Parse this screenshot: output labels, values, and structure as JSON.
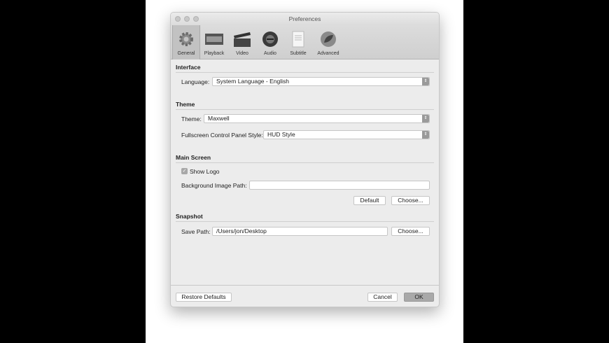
{
  "window": {
    "title": "Preferences"
  },
  "toolbar": [
    {
      "label": "General",
      "icon": "gear-icon"
    },
    {
      "label": "Playback",
      "icon": "film-strip-icon"
    },
    {
      "label": "Video",
      "icon": "clapperboard-icon"
    },
    {
      "label": "Audio",
      "icon": "speaker-icon"
    },
    {
      "label": "Subtitle",
      "icon": "document-icon"
    },
    {
      "label": "Advanced",
      "icon": "advanced-icon"
    }
  ],
  "interface": {
    "heading": "Interface",
    "language_label": "Language:",
    "language_value": "System Language - English"
  },
  "theme": {
    "heading": "Theme",
    "theme_label": "Theme:",
    "theme_value": "Maxwell",
    "fs_label": "Fullscreen Control Panel Style:",
    "fs_value": "HUD Style"
  },
  "main_screen": {
    "heading": "Main Screen",
    "show_logo": "Show Logo",
    "show_logo_checked": true,
    "bg_label": "Background Image Path:",
    "bg_value": "",
    "default_btn": "Default",
    "choose_btn": "Choose..."
  },
  "snapshot": {
    "heading": "Snapshot",
    "save_label": "Save Path:",
    "save_value": "/Users/jon/Desktop",
    "choose_btn": "Choose..."
  },
  "footer": {
    "restore": "Restore Defaults",
    "cancel": "Cancel",
    "ok": "OK"
  }
}
